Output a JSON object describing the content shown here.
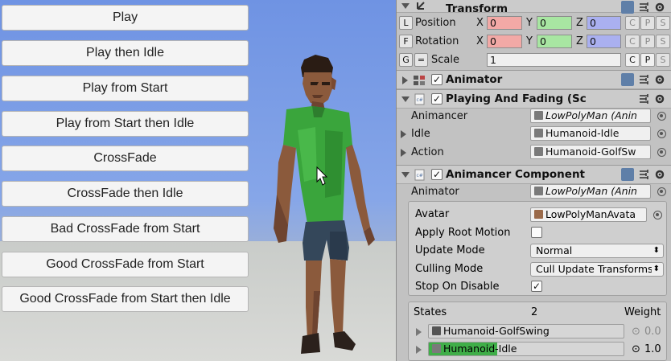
{
  "game_buttons": [
    "Play",
    "Play then Idle",
    "Play from Start",
    "Play from Start then Idle",
    "CrossFade",
    "CrossFade then Idle",
    "Bad CrossFade from Start",
    "Good CrossFade from Start",
    "Good CrossFade from Start then Idle"
  ],
  "transform": {
    "title": "Transform",
    "position_label": "Position",
    "rotation_label": "Rotation",
    "scale_label": "Scale",
    "lock_L": "L",
    "lock_F": "F",
    "lock_G": "G",
    "lock_eq": "=",
    "axis_x": "X",
    "axis_y": "Y",
    "axis_z": "Z",
    "pos_x": "0",
    "pos_y": "0",
    "pos_z": "0",
    "rot_x": "0",
    "rot_y": "0",
    "rot_z": "0",
    "scale": "1",
    "btn_c": "C",
    "btn_p": "P",
    "btn_s": "S",
    "x_color": "#f2a9a6",
    "y_color": "#a8e6a2",
    "z_color": "#aab0f0"
  },
  "animator": {
    "title": "Animator"
  },
  "playing_and_fading": {
    "title": "Playing And Fading (Sc",
    "animancer_label": "Animancer",
    "animancer_value": "LowPolyMan (Anin",
    "idle_label": "Idle",
    "idle_value": "Humanoid-Idle",
    "action_label": "Action",
    "action_value": "Humanoid-GolfSw"
  },
  "animancer_component": {
    "title": "Animancer Component",
    "animator_label": "Animator",
    "animator_value": "LowPolyMan (Anin",
    "avatar_label": "Avatar",
    "avatar_value": "LowPolyManAvata",
    "apply_root_motion_label": "Apply Root Motion",
    "apply_root_motion": false,
    "update_mode_label": "Update Mode",
    "update_mode_value": "Normal",
    "culling_mode_label": "Culling Mode",
    "culling_mode_value": "Cull Update Transforms",
    "stop_on_disable_label": "Stop On Disable",
    "stop_on_disable": true
  },
  "states": {
    "label": "States",
    "count": "2",
    "weight_label": "Weight",
    "items": [
      {
        "name": "Humanoid-GolfSwing",
        "weight": "0.0",
        "progress": 0
      },
      {
        "name": "Humanoid-Idle",
        "weight": "1.0",
        "progress": 0.35
      }
    ]
  },
  "glyphs": {
    "check": "✓",
    "dropdown_arrow": "⬍"
  },
  "colors": {
    "progress_fill": "#3fae48",
    "checkbox_on": "#4a7fd1"
  }
}
